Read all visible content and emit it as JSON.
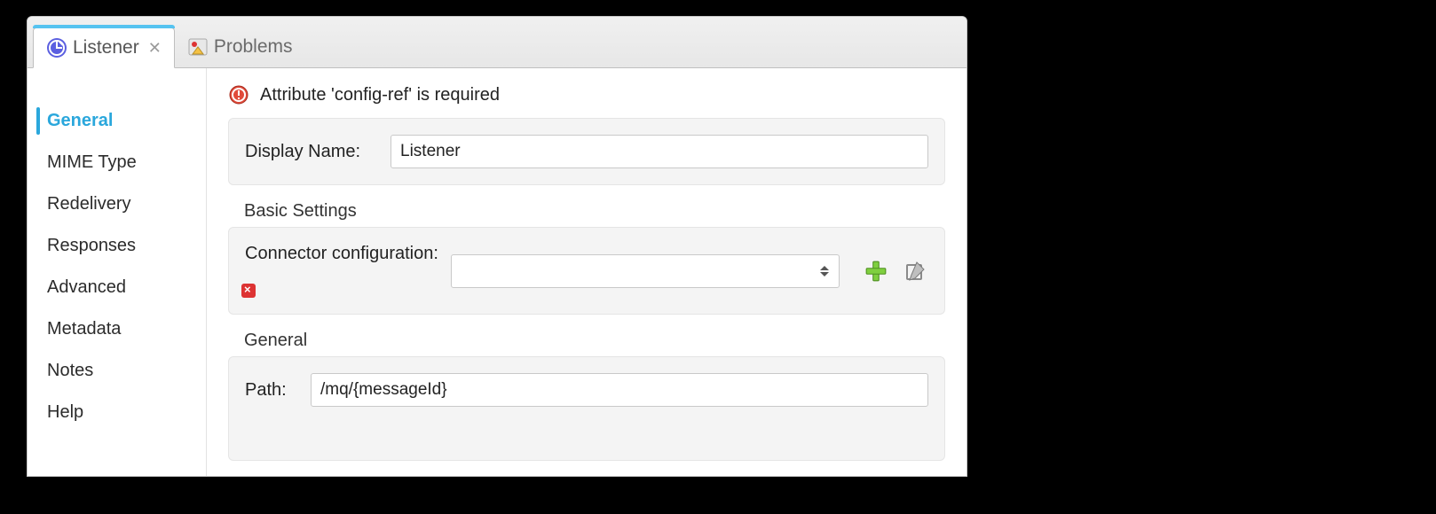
{
  "tabs": {
    "listener": {
      "label": "Listener"
    },
    "problems": {
      "label": "Problems"
    }
  },
  "sidebar": {
    "items": [
      {
        "label": "General",
        "active": true
      },
      {
        "label": "MIME Type"
      },
      {
        "label": "Redelivery"
      },
      {
        "label": "Responses"
      },
      {
        "label": "Advanced"
      },
      {
        "label": "Metadata"
      },
      {
        "label": "Notes"
      },
      {
        "label": "Help"
      }
    ]
  },
  "error": {
    "message": "Attribute 'config-ref' is required"
  },
  "form": {
    "displayName": {
      "label": "Display Name:",
      "value": "Listener"
    },
    "basicSettings": {
      "title": "Basic Settings",
      "connectorConfig": {
        "label": "Connector configuration:",
        "value": ""
      }
    },
    "general": {
      "title": "General",
      "path": {
        "label": "Path:",
        "value": "/mq/{messageId}"
      }
    }
  }
}
